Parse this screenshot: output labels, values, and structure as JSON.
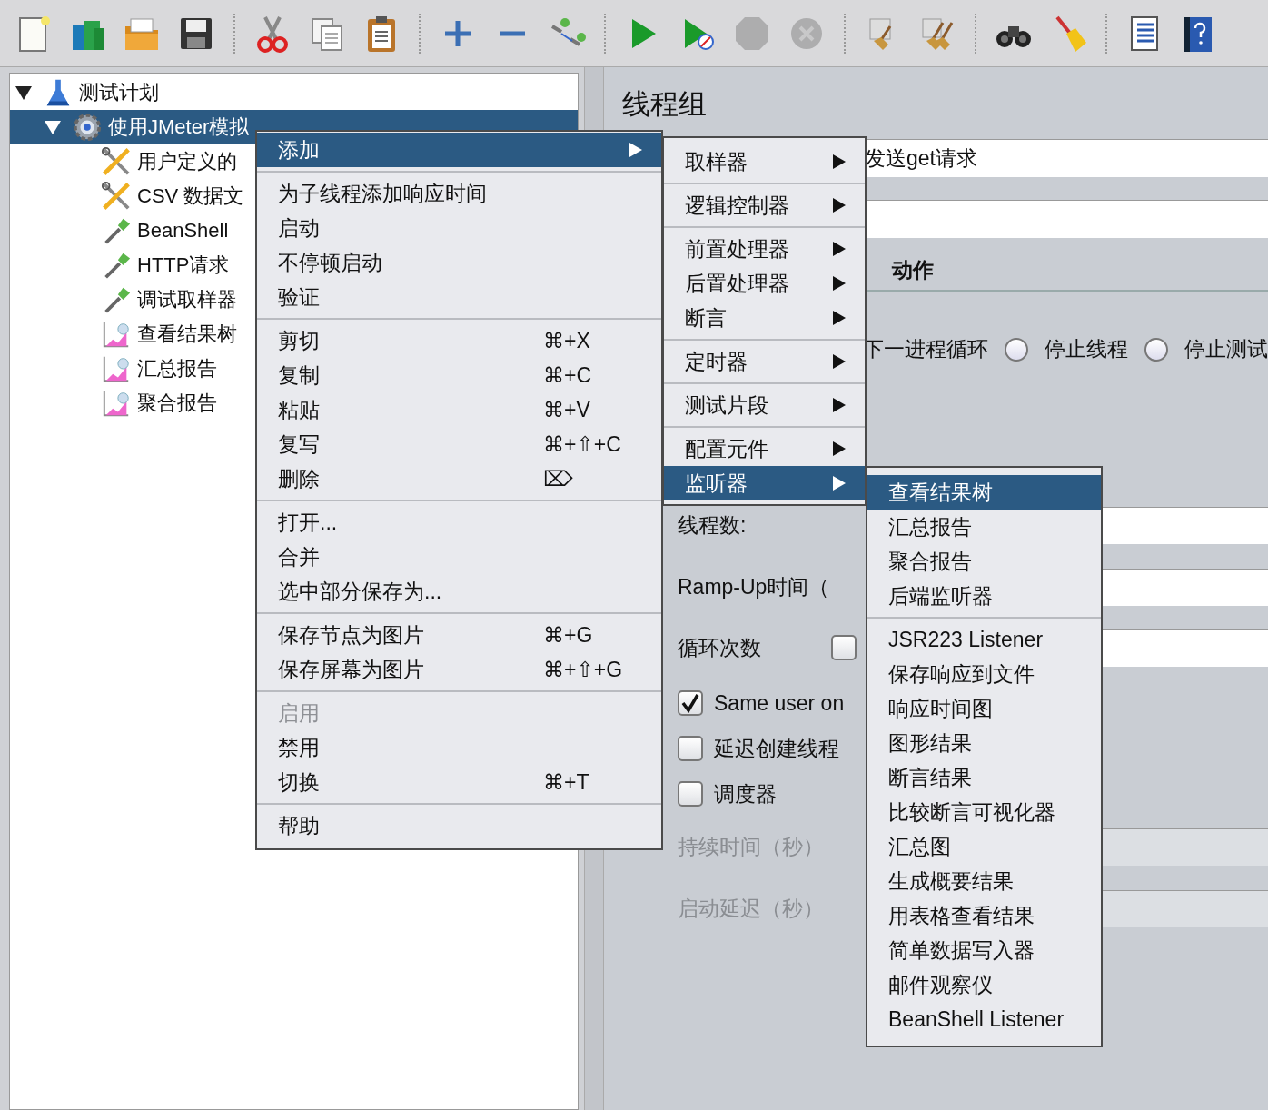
{
  "toolbar": {
    "groups": [
      {
        "items": [
          {
            "kind": "new",
            "disabled": false
          },
          {
            "kind": "templates",
            "disabled": false
          },
          {
            "kind": "open",
            "disabled": false
          },
          {
            "kind": "save",
            "disabled": false
          }
        ]
      },
      {
        "items": [
          {
            "kind": "cut",
            "disabled": false
          },
          {
            "kind": "copy",
            "disabled": false
          },
          {
            "kind": "paste",
            "disabled": false
          }
        ]
      },
      {
        "items": [
          {
            "kind": "expand",
            "disabled": false
          },
          {
            "kind": "collapse",
            "disabled": false
          },
          {
            "kind": "toggle",
            "disabled": false
          }
        ]
      },
      {
        "items": [
          {
            "kind": "start",
            "disabled": false
          },
          {
            "kind": "start-no-pause",
            "disabled": false
          },
          {
            "kind": "stop",
            "disabled": true
          },
          {
            "kind": "shutdown",
            "disabled": true
          }
        ]
      },
      {
        "items": [
          {
            "kind": "clear",
            "disabled": false
          },
          {
            "kind": "clear-all",
            "disabled": false
          }
        ]
      },
      {
        "items": [
          {
            "kind": "search",
            "disabled": false
          },
          {
            "kind": "reset-search",
            "disabled": false
          }
        ]
      },
      {
        "items": [
          {
            "kind": "functions",
            "disabled": false
          },
          {
            "kind": "help",
            "disabled": false
          }
        ]
      }
    ]
  },
  "tree": [
    {
      "label": "测试计划",
      "kind": "flask",
      "expanded": true,
      "selected": false,
      "children": [
        {
          "label": "使用JMeter模拟",
          "kind": "gear",
          "expanded": true,
          "selected": true,
          "children": [
            {
              "label": "用户定义的",
              "kind": "tools",
              "selected": false
            },
            {
              "label": "CSV 数据文",
              "kind": "tools",
              "selected": false
            },
            {
              "label": "BeanShell",
              "kind": "dropper",
              "selected": false
            },
            {
              "label": "HTTP请求",
              "kind": "dropper",
              "selected": false
            },
            {
              "label": "调试取样器",
              "kind": "dropper",
              "selected": false
            },
            {
              "label": "查看结果树",
              "kind": "chart",
              "selected": false
            },
            {
              "label": "汇总报告",
              "kind": "chart",
              "selected": false
            },
            {
              "label": "聚合报告",
              "kind": "chart",
              "selected": false
            }
          ]
        }
      ]
    }
  ],
  "panel": {
    "title": "线程组",
    "name_value": "发送get请求",
    "action_heading": "动作",
    "action_tail": "下一进程循环",
    "action_options": [
      {
        "label": "停止线程",
        "selected": false
      },
      {
        "label": "停止测试",
        "selected": false
      }
    ],
    "properties": [
      {
        "kind": "field",
        "label": "线程数:",
        "disabled": false
      },
      {
        "kind": "field",
        "label": "Ramp-Up时间（",
        "disabled": false
      },
      {
        "kind": "loop",
        "label": "循环次数",
        "checked": false
      },
      {
        "kind": "checkbox",
        "label": "Same user on",
        "checked": true
      },
      {
        "kind": "checkbox",
        "label": "延迟创建线程",
        "checked": false
      },
      {
        "kind": "checkbox",
        "label": "调度器",
        "checked": false
      },
      {
        "kind": "field",
        "label": "持续时间（秒）",
        "disabled": true
      },
      {
        "kind": "field",
        "label": "启动延迟（秒）",
        "disabled": true
      }
    ]
  },
  "context_menu": {
    "groups": [
      {
        "items": [
          {
            "label": "添加",
            "has_submenu": true,
            "selected": true,
            "disabled": false
          }
        ]
      },
      {
        "items": [
          {
            "label": "为子线程添加响应时间",
            "has_submenu": false,
            "selected": false,
            "disabled": false
          },
          {
            "label": "启动",
            "has_submenu": false,
            "selected": false,
            "disabled": false
          },
          {
            "label": "不停顿启动",
            "has_submenu": false,
            "selected": false,
            "disabled": false
          },
          {
            "label": "验证",
            "has_submenu": false,
            "selected": false,
            "disabled": false
          }
        ]
      },
      {
        "items": [
          {
            "label": "剪切",
            "shortcut": "⌘+X",
            "has_submenu": false,
            "selected": false,
            "disabled": false
          },
          {
            "label": "复制",
            "shortcut": "⌘+C",
            "has_submenu": false,
            "selected": false,
            "disabled": false
          },
          {
            "label": "粘贴",
            "shortcut": "⌘+V",
            "has_submenu": false,
            "selected": false,
            "disabled": false
          },
          {
            "label": "复写",
            "shortcut": "⌘+⇧+C",
            "has_submenu": false,
            "selected": false,
            "disabled": false
          },
          {
            "label": "删除",
            "shortcut": "⌦",
            "has_submenu": false,
            "selected": false,
            "disabled": false
          }
        ]
      },
      {
        "items": [
          {
            "label": "打开...",
            "has_submenu": false,
            "selected": false,
            "disabled": false
          },
          {
            "label": "合并",
            "has_submenu": false,
            "selected": false,
            "disabled": false
          },
          {
            "label": "选中部分保存为...",
            "has_submenu": false,
            "selected": false,
            "disabled": false
          }
        ]
      },
      {
        "items": [
          {
            "label": "保存节点为图片",
            "shortcut": "⌘+G",
            "has_submenu": false,
            "selected": false,
            "disabled": false
          },
          {
            "label": "保存屏幕为图片",
            "shortcut": "⌘+⇧+G",
            "has_submenu": false,
            "selected": false,
            "disabled": false
          }
        ]
      },
      {
        "items": [
          {
            "label": "启用",
            "has_submenu": false,
            "selected": false,
            "disabled": true
          },
          {
            "label": "禁用",
            "has_submenu": false,
            "selected": false,
            "disabled": false
          },
          {
            "label": "切换",
            "shortcut": "⌘+T",
            "has_submenu": false,
            "selected": false,
            "disabled": false
          }
        ]
      },
      {
        "items": [
          {
            "label": "帮助",
            "has_submenu": false,
            "selected": false,
            "disabled": false
          }
        ]
      }
    ]
  },
  "add_menu": {
    "groups": [
      {
        "items": [
          {
            "label": "取样器",
            "has_submenu": true,
            "selected": false
          }
        ]
      },
      {
        "items": [
          {
            "label": "逻辑控制器",
            "has_submenu": true,
            "selected": false
          }
        ]
      },
      {
        "items": [
          {
            "label": "前置处理器",
            "has_submenu": true,
            "selected": false
          },
          {
            "label": "后置处理器",
            "has_submenu": true,
            "selected": false
          },
          {
            "label": "断言",
            "has_submenu": true,
            "selected": false
          }
        ]
      },
      {
        "items": [
          {
            "label": "定时器",
            "has_submenu": true,
            "selected": false
          }
        ]
      },
      {
        "items": [
          {
            "label": "测试片段",
            "has_submenu": true,
            "selected": false
          }
        ]
      },
      {
        "items": [
          {
            "label": "配置元件",
            "has_submenu": true,
            "selected": false
          },
          {
            "label": "监听器",
            "has_submenu": true,
            "selected": true
          }
        ]
      }
    ]
  },
  "listener_menu": {
    "groups": [
      {
        "items": [
          {
            "label": "查看结果树",
            "selected": true
          },
          {
            "label": "汇总报告",
            "selected": false
          },
          {
            "label": "聚合报告",
            "selected": false
          },
          {
            "label": "后端监听器",
            "selected": false
          }
        ]
      },
      {
        "items": [
          {
            "label": "JSR223 Listener",
            "selected": false
          },
          {
            "label": "保存响应到文件",
            "selected": false
          },
          {
            "label": "响应时间图",
            "selected": false
          },
          {
            "label": "图形结果",
            "selected": false
          },
          {
            "label": "断言结果",
            "selected": false
          },
          {
            "label": "比较断言可视化器",
            "selected": false
          },
          {
            "label": "汇总图",
            "selected": false
          },
          {
            "label": "生成概要结果",
            "selected": false
          },
          {
            "label": "用表格查看结果",
            "selected": false
          },
          {
            "label": "简单数据写入器",
            "selected": false
          },
          {
            "label": "邮件观察仪",
            "selected": false
          },
          {
            "label": "BeanShell Listener",
            "selected": false
          }
        ]
      }
    ]
  }
}
